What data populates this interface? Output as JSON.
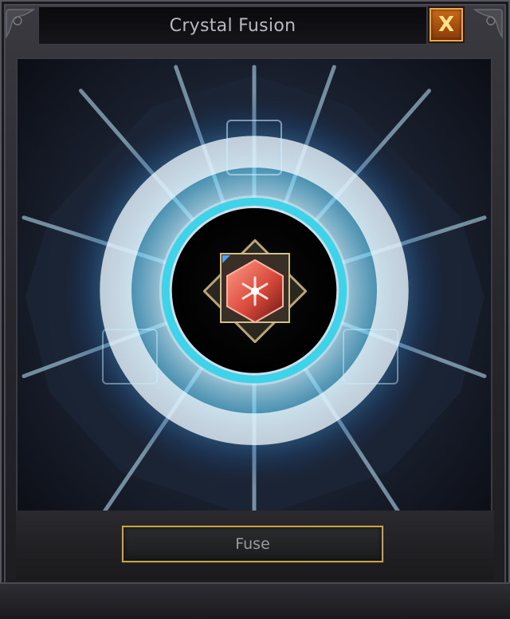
{
  "window": {
    "title": "Crystal Fusion",
    "close_label": "X"
  },
  "fusion": {
    "center_slot": {
      "item": "red-crystal-icon",
      "filled": true
    },
    "material_slots": [
      {
        "position": "top",
        "filled": false
      },
      {
        "position": "left",
        "filled": false
      },
      {
        "position": "right",
        "filled": false
      }
    ]
  },
  "actions": {
    "fuse_label": "Fuse"
  },
  "colors": {
    "glow": "#3fd3ea",
    "accent": "#c9a24b",
    "crystal": "#d94a3c",
    "close": "#c86a18"
  }
}
